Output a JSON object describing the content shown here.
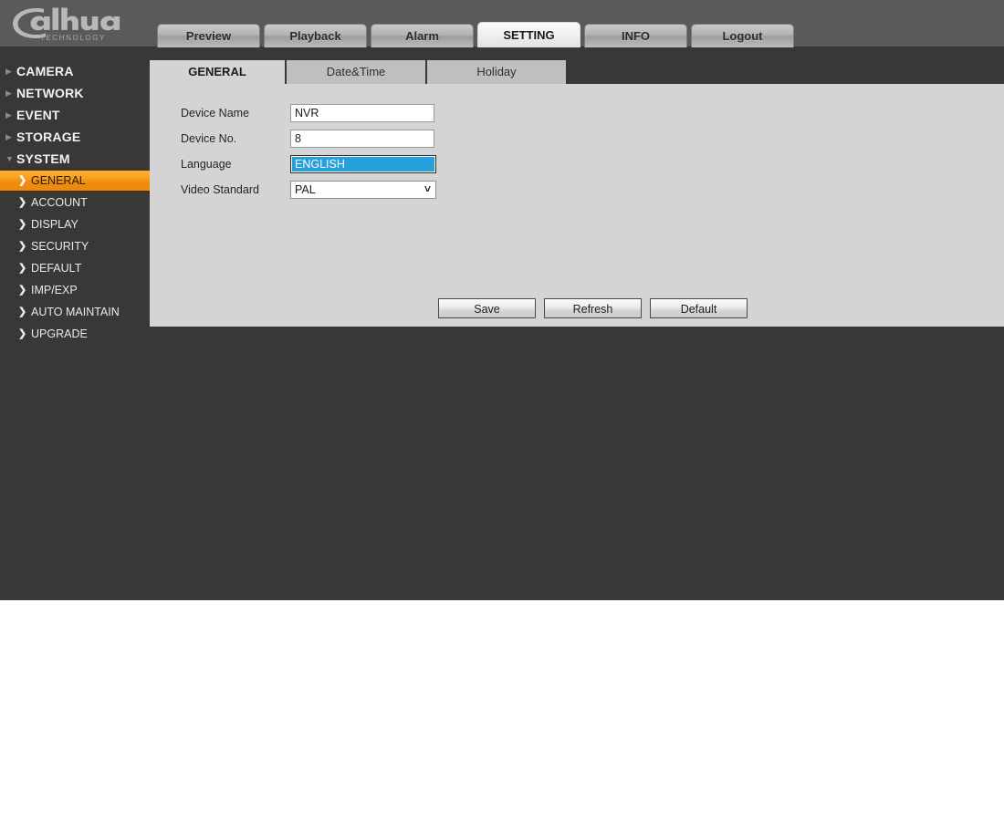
{
  "brand": {
    "name": "alhua",
    "wordmark": "dahua",
    "tagline": "TECHNOLOGY"
  },
  "topnav": {
    "items": [
      {
        "label": "Preview",
        "active": false
      },
      {
        "label": "Playback",
        "active": false
      },
      {
        "label": "Alarm",
        "active": false
      },
      {
        "label": "SETTING",
        "active": true
      },
      {
        "label": "INFO",
        "active": false
      },
      {
        "label": "Logout",
        "active": false
      }
    ]
  },
  "sidebar": {
    "groups": [
      {
        "label": "CAMERA",
        "expanded": false,
        "icon": "triangle-right-icon"
      },
      {
        "label": "NETWORK",
        "expanded": false,
        "icon": "triangle-right-icon"
      },
      {
        "label": "EVENT",
        "expanded": false,
        "icon": "triangle-right-icon"
      },
      {
        "label": "STORAGE",
        "expanded": false,
        "icon": "triangle-right-icon"
      },
      {
        "label": "SYSTEM",
        "expanded": true,
        "icon": "triangle-down-icon"
      }
    ],
    "system_items": [
      {
        "label": "GENERAL",
        "selected": true,
        "icon": "chevron-right-icon"
      },
      {
        "label": "ACCOUNT",
        "selected": false,
        "icon": "chevron-right-icon"
      },
      {
        "label": "DISPLAY",
        "selected": false,
        "icon": "chevron-right-icon"
      },
      {
        "label": "SECURITY",
        "selected": false,
        "icon": "chevron-right-icon"
      },
      {
        "label": "DEFAULT",
        "selected": false,
        "icon": "chevron-right-icon"
      },
      {
        "label": "IMP/EXP",
        "selected": false,
        "icon": "chevron-right-icon"
      },
      {
        "label": "AUTO MAINTAIN",
        "selected": false,
        "icon": "chevron-right-icon"
      },
      {
        "label": "UPGRADE",
        "selected": false,
        "icon": "chevron-right-icon"
      }
    ]
  },
  "subtabs": {
    "items": [
      {
        "label": "GENERAL",
        "active": true
      },
      {
        "label": "Date&Time",
        "active": false
      },
      {
        "label": "Holiday",
        "active": false
      }
    ]
  },
  "form": {
    "device_name": {
      "label": "Device Name",
      "value": "NVR",
      "placeholder": ""
    },
    "device_no": {
      "label": "Device No.",
      "value": "8",
      "placeholder": ""
    },
    "language": {
      "label": "Language",
      "value": "ENGLISH"
    },
    "video_standard": {
      "label": "Video Standard",
      "value": "PAL",
      "arrow": "⌄"
    }
  },
  "buttons": {
    "save": "Save",
    "refresh": "Refresh",
    "default": "Default"
  },
  "colors": {
    "header_band": "#5a5a5a",
    "page_body": "#383838",
    "panel": "#d4d4d4",
    "subtab_inactive": "#bfbfbf",
    "accent_orange": "#f5a01e",
    "select_highlight": "#26a0da"
  }
}
